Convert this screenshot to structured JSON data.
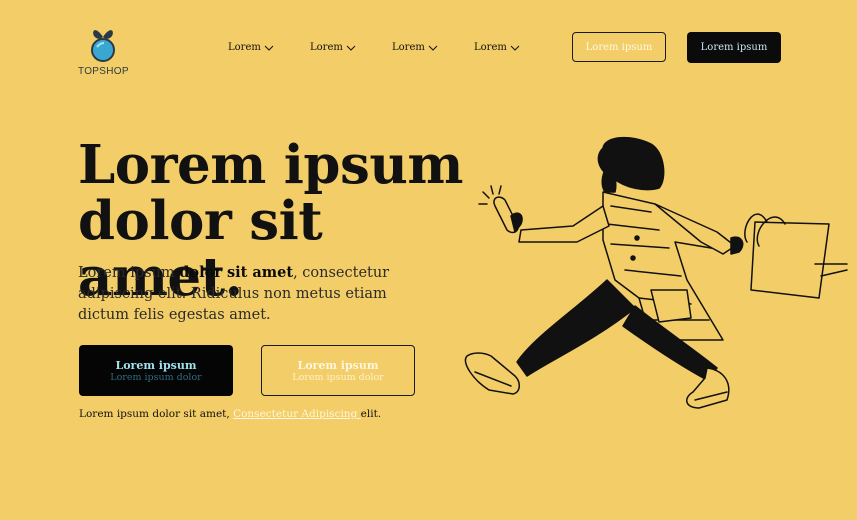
{
  "brand": {
    "name": "TOPSHOP"
  },
  "nav": {
    "items": [
      {
        "label": "Lorem"
      },
      {
        "label": "Lorem"
      },
      {
        "label": "Lorem"
      },
      {
        "label": "Lorem"
      }
    ],
    "outline_button": "Lorem ipsum",
    "dark_button": "Lorem ipsum"
  },
  "hero": {
    "title_line1": "Lorem ipsum",
    "title_line2": "dolor sit amet.",
    "desc_pre": "Lorem ipsum ",
    "desc_bold": "dolor sit amet",
    "desc_post": ", consectetur adipiscing elit. Ridiculus non metus etiam dictum felis egestas amet.",
    "cta_primary": {
      "title": "Lorem ipsum",
      "subtitle": "Lorem ipsum dolor"
    },
    "cta_secondary": {
      "title": "Lorem ipsum",
      "subtitle": "Lorem ipsum dolor"
    },
    "footnote_pre": "Lorem ipsum dolor sit amet, ",
    "footnote_link": "Consectetur Adipiscing ",
    "footnote_post": "elit."
  },
  "colors": {
    "background": "#f3cd67",
    "dark": "#050505",
    "accent_cyan": "#9fe1ee"
  },
  "icons": {
    "logo": "fruit-logo-icon",
    "nav_chevron": "chevron-down-icon"
  }
}
